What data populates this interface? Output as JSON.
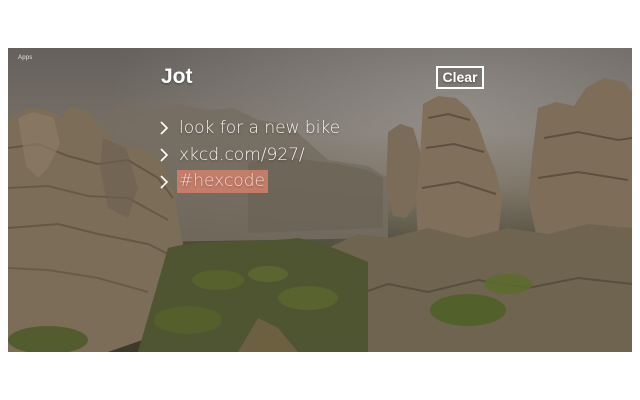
{
  "header": {
    "apps_label": "Apps",
    "title": "Jot",
    "clear_label": "Clear"
  },
  "notes": [
    {
      "text": "look for a new bike",
      "highlighted": false,
      "icon": "chevron-right-icon"
    },
    {
      "text": "xkcd.com/927/",
      "highlighted": false,
      "icon": "chevron-right-icon"
    },
    {
      "text": "#hexcode",
      "highlighted": true,
      "highlight_color": "#d2806c",
      "icon": "chevron-right-icon"
    }
  ],
  "colors": {
    "frame": "#ffffff",
    "text": "#f6f3ef",
    "highlight": "#d2806c"
  }
}
